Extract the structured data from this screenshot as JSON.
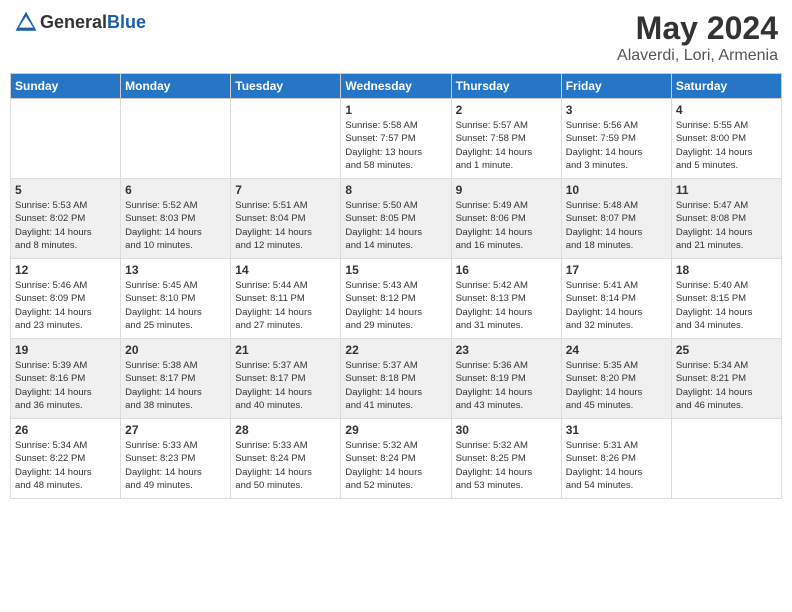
{
  "logo": {
    "text_general": "General",
    "text_blue": "Blue"
  },
  "header": {
    "month": "May 2024",
    "location": "Alaverdi, Lori, Armenia"
  },
  "weekdays": [
    "Sunday",
    "Monday",
    "Tuesday",
    "Wednesday",
    "Thursday",
    "Friday",
    "Saturday"
  ],
  "rows": [
    {
      "shaded": false,
      "cells": [
        {
          "day": "",
          "content": ""
        },
        {
          "day": "",
          "content": ""
        },
        {
          "day": "",
          "content": ""
        },
        {
          "day": "1",
          "content": "Sunrise: 5:58 AM\nSunset: 7:57 PM\nDaylight: 13 hours\nand 58 minutes."
        },
        {
          "day": "2",
          "content": "Sunrise: 5:57 AM\nSunset: 7:58 PM\nDaylight: 14 hours\nand 1 minute."
        },
        {
          "day": "3",
          "content": "Sunrise: 5:56 AM\nSunset: 7:59 PM\nDaylight: 14 hours\nand 3 minutes."
        },
        {
          "day": "4",
          "content": "Sunrise: 5:55 AM\nSunset: 8:00 PM\nDaylight: 14 hours\nand 5 minutes."
        }
      ]
    },
    {
      "shaded": true,
      "cells": [
        {
          "day": "5",
          "content": "Sunrise: 5:53 AM\nSunset: 8:02 PM\nDaylight: 14 hours\nand 8 minutes."
        },
        {
          "day": "6",
          "content": "Sunrise: 5:52 AM\nSunset: 8:03 PM\nDaylight: 14 hours\nand 10 minutes."
        },
        {
          "day": "7",
          "content": "Sunrise: 5:51 AM\nSunset: 8:04 PM\nDaylight: 14 hours\nand 12 minutes."
        },
        {
          "day": "8",
          "content": "Sunrise: 5:50 AM\nSunset: 8:05 PM\nDaylight: 14 hours\nand 14 minutes."
        },
        {
          "day": "9",
          "content": "Sunrise: 5:49 AM\nSunset: 8:06 PM\nDaylight: 14 hours\nand 16 minutes."
        },
        {
          "day": "10",
          "content": "Sunrise: 5:48 AM\nSunset: 8:07 PM\nDaylight: 14 hours\nand 18 minutes."
        },
        {
          "day": "11",
          "content": "Sunrise: 5:47 AM\nSunset: 8:08 PM\nDaylight: 14 hours\nand 21 minutes."
        }
      ]
    },
    {
      "shaded": false,
      "cells": [
        {
          "day": "12",
          "content": "Sunrise: 5:46 AM\nSunset: 8:09 PM\nDaylight: 14 hours\nand 23 minutes."
        },
        {
          "day": "13",
          "content": "Sunrise: 5:45 AM\nSunset: 8:10 PM\nDaylight: 14 hours\nand 25 minutes."
        },
        {
          "day": "14",
          "content": "Sunrise: 5:44 AM\nSunset: 8:11 PM\nDaylight: 14 hours\nand 27 minutes."
        },
        {
          "day": "15",
          "content": "Sunrise: 5:43 AM\nSunset: 8:12 PM\nDaylight: 14 hours\nand 29 minutes."
        },
        {
          "day": "16",
          "content": "Sunrise: 5:42 AM\nSunset: 8:13 PM\nDaylight: 14 hours\nand 31 minutes."
        },
        {
          "day": "17",
          "content": "Sunrise: 5:41 AM\nSunset: 8:14 PM\nDaylight: 14 hours\nand 32 minutes."
        },
        {
          "day": "18",
          "content": "Sunrise: 5:40 AM\nSunset: 8:15 PM\nDaylight: 14 hours\nand 34 minutes."
        }
      ]
    },
    {
      "shaded": true,
      "cells": [
        {
          "day": "19",
          "content": "Sunrise: 5:39 AM\nSunset: 8:16 PM\nDaylight: 14 hours\nand 36 minutes."
        },
        {
          "day": "20",
          "content": "Sunrise: 5:38 AM\nSunset: 8:17 PM\nDaylight: 14 hours\nand 38 minutes."
        },
        {
          "day": "21",
          "content": "Sunrise: 5:37 AM\nSunset: 8:17 PM\nDaylight: 14 hours\nand 40 minutes."
        },
        {
          "day": "22",
          "content": "Sunrise: 5:37 AM\nSunset: 8:18 PM\nDaylight: 14 hours\nand 41 minutes."
        },
        {
          "day": "23",
          "content": "Sunrise: 5:36 AM\nSunset: 8:19 PM\nDaylight: 14 hours\nand 43 minutes."
        },
        {
          "day": "24",
          "content": "Sunrise: 5:35 AM\nSunset: 8:20 PM\nDaylight: 14 hours\nand 45 minutes."
        },
        {
          "day": "25",
          "content": "Sunrise: 5:34 AM\nSunset: 8:21 PM\nDaylight: 14 hours\nand 46 minutes."
        }
      ]
    },
    {
      "shaded": false,
      "cells": [
        {
          "day": "26",
          "content": "Sunrise: 5:34 AM\nSunset: 8:22 PM\nDaylight: 14 hours\nand 48 minutes."
        },
        {
          "day": "27",
          "content": "Sunrise: 5:33 AM\nSunset: 8:23 PM\nDaylight: 14 hours\nand 49 minutes."
        },
        {
          "day": "28",
          "content": "Sunrise: 5:33 AM\nSunset: 8:24 PM\nDaylight: 14 hours\nand 50 minutes."
        },
        {
          "day": "29",
          "content": "Sunrise: 5:32 AM\nSunset: 8:24 PM\nDaylight: 14 hours\nand 52 minutes."
        },
        {
          "day": "30",
          "content": "Sunrise: 5:32 AM\nSunset: 8:25 PM\nDaylight: 14 hours\nand 53 minutes."
        },
        {
          "day": "31",
          "content": "Sunrise: 5:31 AM\nSunset: 8:26 PM\nDaylight: 14 hours\nand 54 minutes."
        },
        {
          "day": "",
          "content": ""
        }
      ]
    }
  ]
}
